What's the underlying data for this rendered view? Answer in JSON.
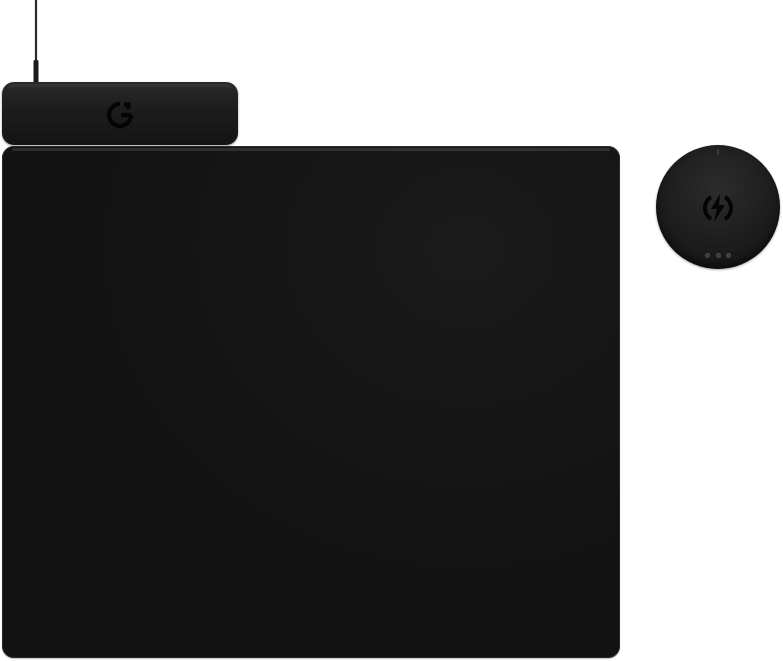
{
  "scene": {
    "description_items": [
      "cable",
      "base-unit",
      "mousepad",
      "charging-puck"
    ],
    "colors": {
      "background": "#ffffff",
      "device_black": "#121212",
      "base_unit": "#1c1c1c",
      "logo": "#050505",
      "led": "#3a3a3a"
    },
    "icons": {
      "base_logo": "logitech-g-icon",
      "puck_symbol": "charging-bolt-icon"
    },
    "puck_led_count": 3
  }
}
